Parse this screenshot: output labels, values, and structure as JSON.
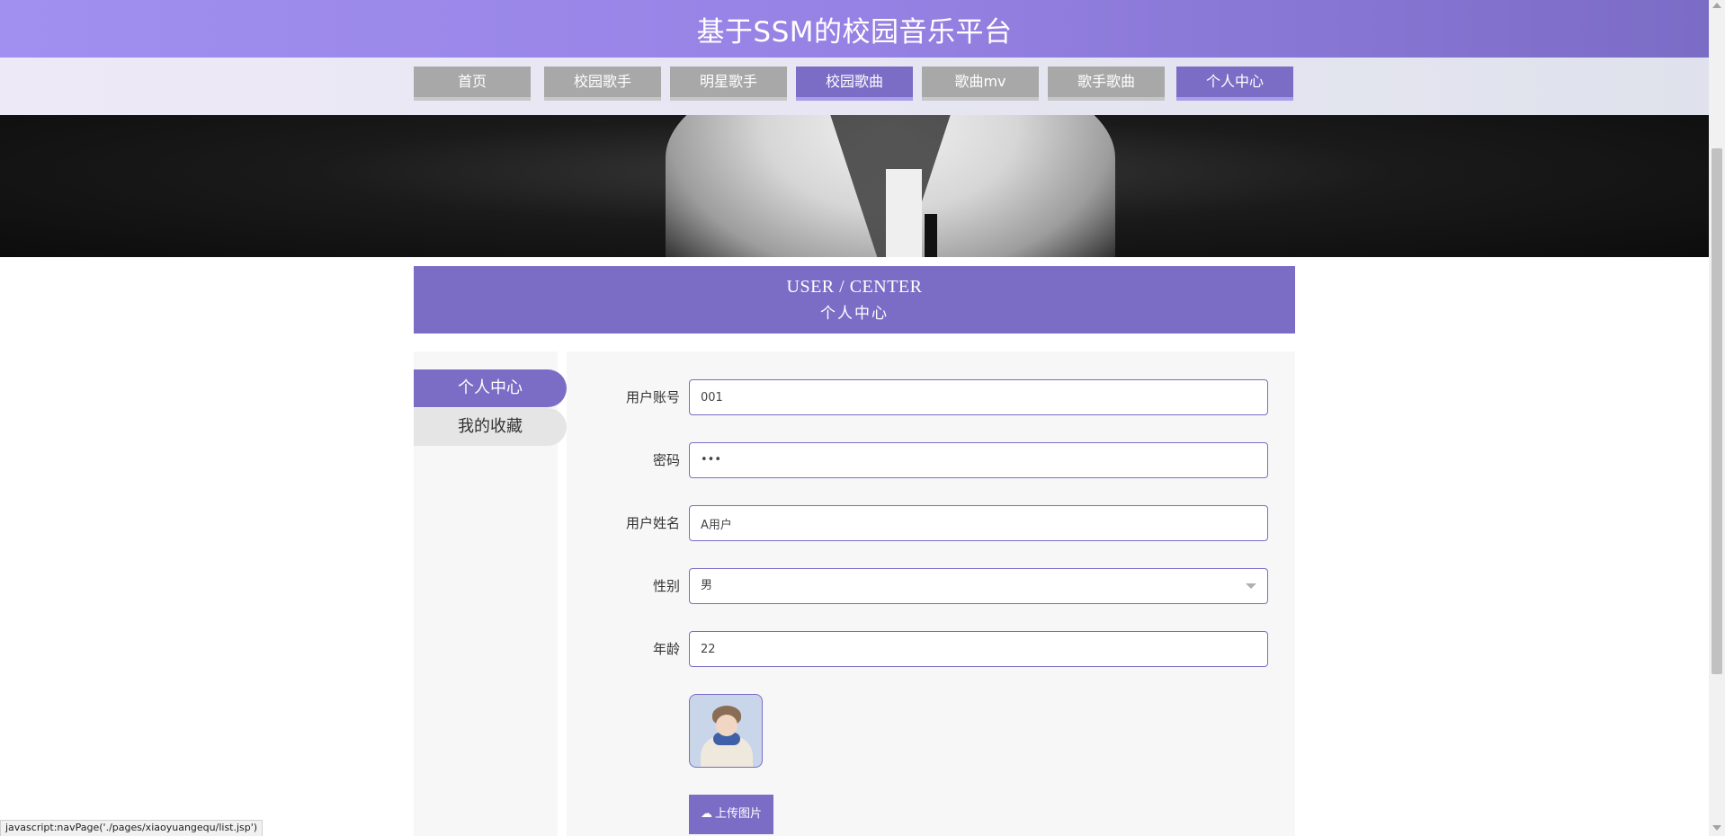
{
  "header": {
    "title": "基于SSM的校园音乐平台"
  },
  "nav": {
    "items": [
      {
        "label": "首页"
      },
      {
        "label": "校园歌手"
      },
      {
        "label": "明星歌手"
      },
      {
        "label": "校园歌曲"
      },
      {
        "label": "歌曲mv"
      },
      {
        "label": "歌手歌曲"
      },
      {
        "label": "个人中心"
      }
    ],
    "active": "个人中心",
    "hovered": "校园歌曲"
  },
  "section": {
    "title_en": "USER / CENTER",
    "title_cn": "个人中心"
  },
  "sidebar": {
    "items": [
      {
        "label": "个人中心"
      },
      {
        "label": "我的收藏"
      }
    ],
    "active": "个人中心"
  },
  "form": {
    "account": {
      "label": "用户账号",
      "value": "001"
    },
    "password": {
      "label": "密码",
      "value": "•••"
    },
    "name": {
      "label": "用户姓名",
      "value": "A用户"
    },
    "gender": {
      "label": "性别",
      "value": "男"
    },
    "age": {
      "label": "年龄",
      "value": "22"
    },
    "upload_label": "上传图片",
    "upload_icon": "cloud-upload-icon"
  },
  "statusbar": {
    "text": "javascript:navPage('./pages/xiaoyuangequ/list.jsp')"
  },
  "colors": {
    "accent": "#7b6dc6",
    "header_start": "#a190f0",
    "nav_inactive": "#a8a8a8"
  }
}
